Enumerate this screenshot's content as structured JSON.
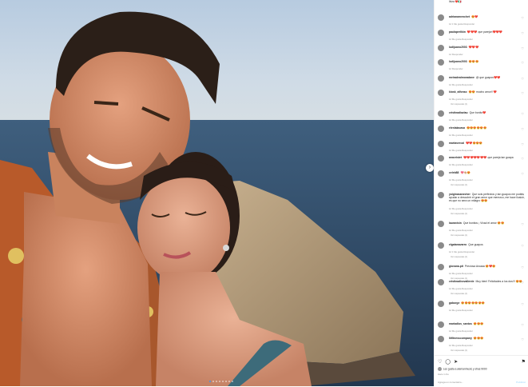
{
  "post": {
    "caption_tail": "Ibiza ❤️🇮🇹",
    "nav_next": "›",
    "image_alt": "Couple selfie by the sea at sunset"
  },
  "comments": [
    {
      "user": "adrianamenchet",
      "text": "😍❤️",
      "meta": "1d  1 Me gusta  Responder",
      "replies": ""
    },
    {
      "user": "paulaperlikin",
      "text": "❤️❤️❤️ que parejon❤️❤️❤️",
      "meta": "1d  Me gusta  Responder",
      "replies": ""
    },
    {
      "user": "ludijuano2003",
      "text": "❤️❤️❤️",
      "meta": "1d  Responder",
      "replies": ""
    },
    {
      "user": "ludijuano2003",
      "text": "😍😍😍",
      "meta": "1d  Responder",
      "replies": ""
    },
    {
      "user": "meiradealmoradave",
      "text": "@ que guapos❤️❤️",
      "meta": "1d  Me gusta  Responder",
      "replies": ""
    },
    {
      "user": "kiosk_alfonso",
      "text": "😍😍 mucho amor!! ❤️",
      "meta": "1d  Me gusta  Responder",
      "replies": "Ver respuestas (1)"
    },
    {
      "user": "cristinadiazlau",
      "text": "Que bonito❤️",
      "meta": "1d  Me gusta  Responder",
      "replies": ""
    },
    {
      "user": "elenlalacasa",
      "text": "😍😍😍😍😍😍",
      "meta": "1d  Me gusta  Responder",
      "replies": ""
    },
    {
      "user": "martavercal",
      "text": "❤️❤️😍😍😍",
      "meta": "1d  Me gusta  Responder",
      "replies": ""
    },
    {
      "user": "anacristet",
      "text": "❤️❤️❤️❤️❤️❤️❤️ que pareja tan guapa",
      "meta": "1d  Me gusta  Responder",
      "replies": ""
    },
    {
      "user": "celeb88",
      "text": "💖👏🏼😍",
      "meta": "1d  Me gusta  Responder",
      "replies": "Ver respuestas (1)"
    },
    {
      "user": "yoiginasanecher",
      "text": "Que sois perfectos y tan guapos me podeis ayudar a descubrir el gran amor que merezco, me hace ilusion, es que no sera un milagro 😍😍",
      "meta": "1d  Me gusta  Responder",
      "replies": "Ver respuestas (1)"
    },
    {
      "user": "lauravisin",
      "text": "Que bonitos ¡ Vivad el amor 😍😍",
      "meta": "1d  Me gusta  Responder",
      "replies": "Ver respuestas (1)"
    },
    {
      "user": "elgatanavarro",
      "text": "Que guapos",
      "meta": "1d  1 Me gusta  Responder",
      "replies": "Ver respuestas (1)"
    },
    {
      "user": "giovana.pit",
      "text": "Preciosa Aroaaa 😍❤️😍",
      "meta": "1d  Me gusta  Responder",
      "replies": "Ver respuestas (1)"
    },
    {
      "user": "cristinadiezvallerde",
      "text": "Muy bien! Felicitades a los dos!!! 😍😍",
      "meta": "1d  Me gusta  Responder",
      "replies": "Ver respuestas (1)"
    },
    {
      "user": "gaborge",
      "text": "😍😍😍😍😍😍😍",
      "meta": "1d  Me gusta  Responder",
      "replies": ""
    },
    {
      "user": "mariadlos_santos",
      "text": "😍😍😍",
      "meta": "1d  Me gusta  Responder",
      "replies": ""
    },
    {
      "user": "lhfitnesscompany",
      "text": "😍😍😍",
      "meta": "1d  Me gusta  Responder",
      "replies": "Ver respuestas (1)"
    }
  ],
  "actions": {
    "liked_by": "Les gusta a alemanmusic y otras 9000",
    "date": "Hace 1 día",
    "add_comment_placeholder": "Agrega un comentario...",
    "publish_label": "Publicar"
  },
  "icons": [
    "like-icon",
    "comment-icon",
    "share-icon",
    "save-icon",
    "heart-icon"
  ]
}
